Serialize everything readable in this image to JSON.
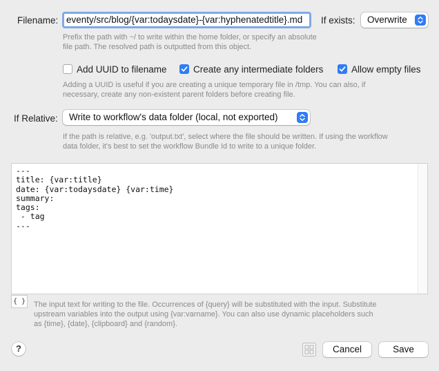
{
  "filename": {
    "label": "Filename:",
    "value": "eventy/src/blog/{var:todaysdate}-{var:hyphenatedtitle}.md",
    "help": "Prefix the path with ~/ to write within the home folder, or specify an absolute file path. The resolved path is outputted from this object."
  },
  "if_exists": {
    "label": "If exists:",
    "value": "Overwrite"
  },
  "options": {
    "add_uuid": {
      "label": "Add UUID to filename",
      "checked": false
    },
    "create_folders": {
      "label": "Create any intermediate folders",
      "checked": true
    },
    "allow_empty": {
      "label": "Allow empty files",
      "checked": true
    },
    "help": "Adding a UUID is useful if you are creating a unique temporary file in /tmp. You can also, if necessary, create any non-existent parent folders before creating file."
  },
  "if_relative": {
    "label": "If Relative:",
    "value": "Write to workflow's data folder (local, not exported)",
    "help": "If the path is relative, e.g. 'output.txt', select where the file should be written. If using the workflow data folder, it's best to set the workflow Bundle Id to write to a unique folder."
  },
  "editor": {
    "content": "---\ntitle: {var:title}\ndate: {var:todaysdate} {var:time}\nsummary:\ntags:\n - tag\n---",
    "braces_label": "{ }",
    "help": "The input text for writing to the file. Occurrences of {query} will be substituted with the input. Substitute upstream variables into the output using {var:varname}. You can also use dynamic placeholders such as {time}, {date}, {clipboard} and {random}."
  },
  "footer": {
    "help_label": "?",
    "cancel_label": "Cancel",
    "save_label": "Save"
  },
  "colors": {
    "accent": "#2f7cf6",
    "focus_ring": "#7fa9e6",
    "window_bg": "#ececec",
    "help_text": "#8a8a8a"
  },
  "icons": {
    "stepper": "chevron-up-down-icon",
    "checkbox": "checkmark-icon",
    "help": "question-mark-icon",
    "grid": "grid-icon"
  }
}
